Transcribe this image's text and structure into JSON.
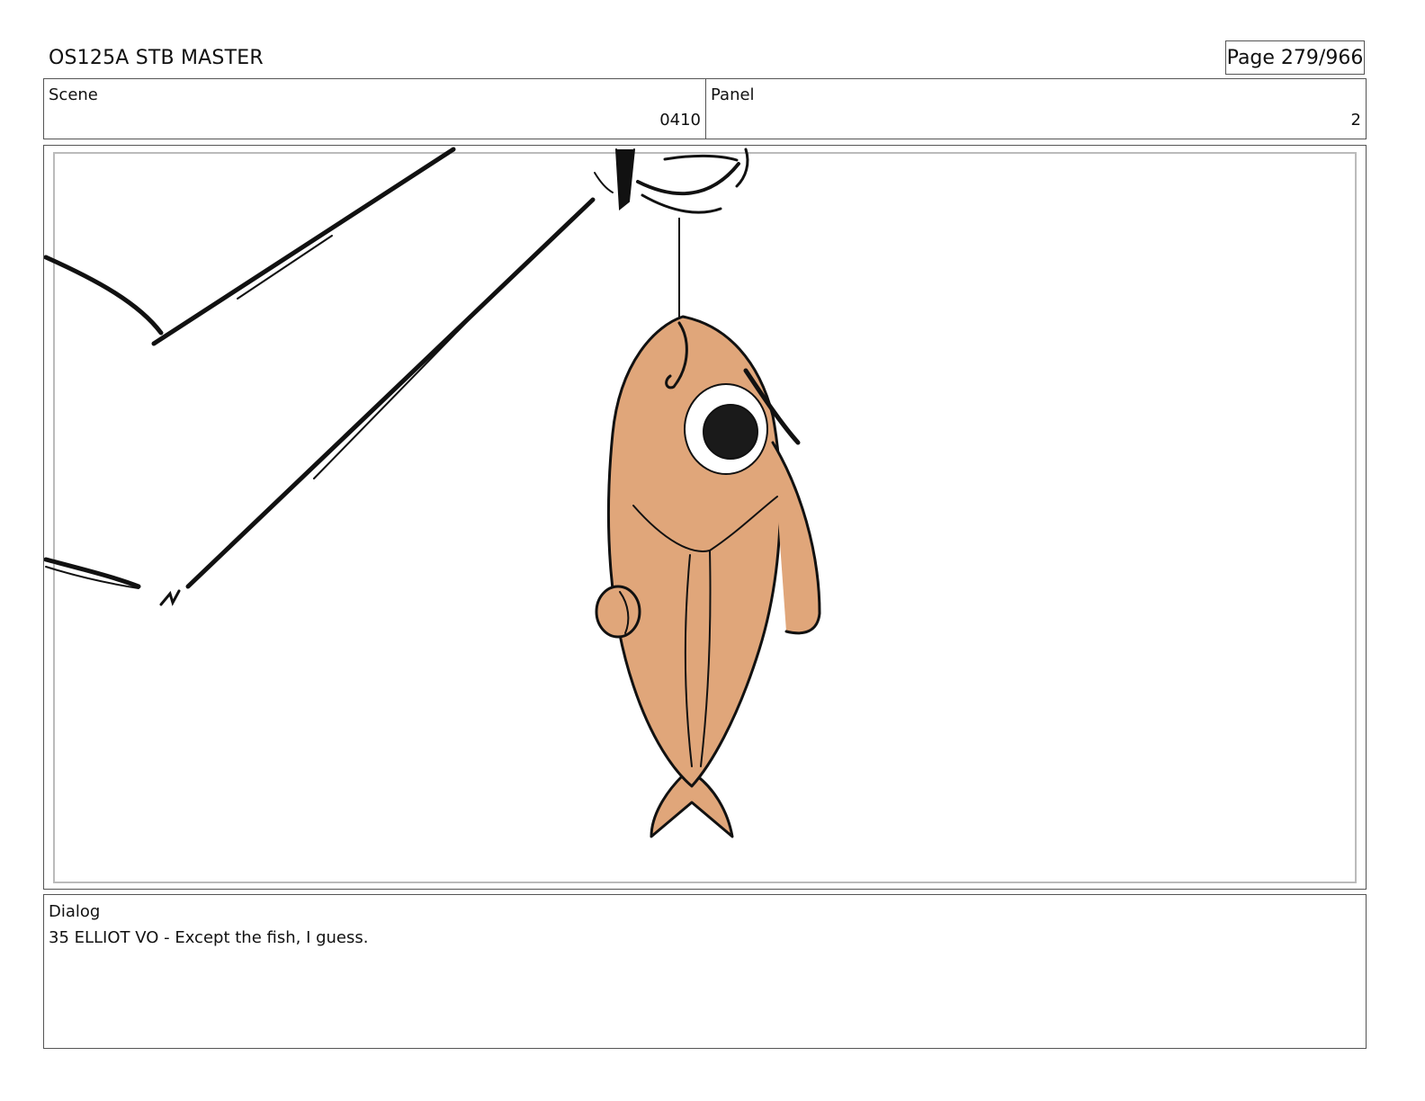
{
  "header": {
    "title": "OS125A STB MASTER",
    "page_label": "Page 279/966"
  },
  "meta": {
    "scene_label": "Scene",
    "scene_value": "0410",
    "panel_label": "Panel",
    "panel_value": "2"
  },
  "artwork": {
    "description_icon": "hanging-fish-sketch",
    "fish_color": "#E0A67A",
    "line_color": "#111111"
  },
  "dialog": {
    "label": "Dialog",
    "text": "35 ELLIOT VO - Except the fish, I guess."
  }
}
